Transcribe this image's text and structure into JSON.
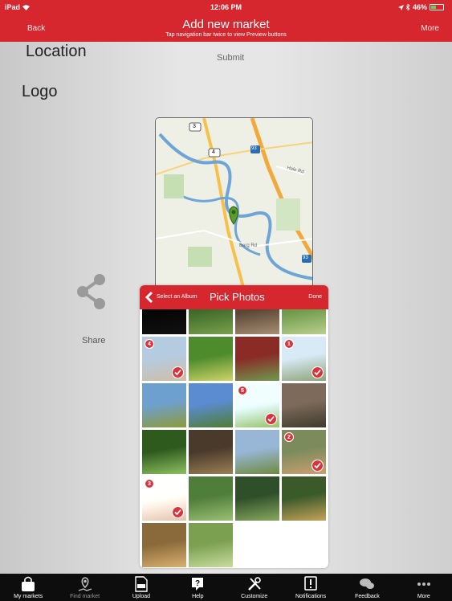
{
  "status_bar": {
    "carrier": "iPad",
    "time": "12:06 PM",
    "battery": "46%",
    "battery_level": 0.46
  },
  "nav": {
    "back": "Back",
    "title": "Add new market",
    "subtitle": "Tap navigation bar twice to view Preview buttons",
    "more": "More"
  },
  "form": {
    "location_label": "Location",
    "submit_label": "Submit",
    "logo_label": "Logo",
    "share_label": "Share"
  },
  "map": {
    "route_shields": [
      "3",
      "4",
      "93",
      "93"
    ],
    "roads": [
      "Hale Rd",
      "Borg Rd"
    ]
  },
  "picker": {
    "back_label": "Select an Album",
    "title": "Pick Photos",
    "done_label": "Done"
  },
  "photos": [
    {
      "badge": "",
      "selected": false
    },
    {
      "badge": "",
      "selected": false
    },
    {
      "badge": "",
      "selected": false
    },
    {
      "badge": "",
      "selected": false
    },
    {
      "badge": "4",
      "selected": true
    },
    {
      "badge": "",
      "selected": false
    },
    {
      "badge": "",
      "selected": false
    },
    {
      "badge": "1",
      "selected": true
    },
    {
      "badge": "",
      "selected": false
    },
    {
      "badge": "",
      "selected": false
    },
    {
      "badge": "5",
      "selected": true
    },
    {
      "badge": "",
      "selected": false
    },
    {
      "badge": "",
      "selected": false
    },
    {
      "badge": "",
      "selected": false
    },
    {
      "badge": "",
      "selected": false
    },
    {
      "badge": "2",
      "selected": true
    },
    {
      "badge": "3",
      "selected": true
    },
    {
      "badge": "",
      "selected": false
    },
    {
      "badge": "",
      "selected": false
    },
    {
      "badge": "",
      "selected": false
    },
    {
      "badge": "",
      "selected": false
    },
    {
      "badge": "",
      "selected": false
    }
  ],
  "tabs": [
    {
      "label": "My markets",
      "icon": "bag-icon"
    },
    {
      "label": "Find market",
      "icon": "map-pin-icon"
    },
    {
      "label": "Upload",
      "icon": "pdf-icon"
    },
    {
      "label": "Help",
      "icon": "help-icon"
    },
    {
      "label": "Customize",
      "icon": "tools-icon"
    },
    {
      "label": "Notifications",
      "icon": "notification-icon"
    },
    {
      "label": "Feedback",
      "icon": "feedback-icon"
    },
    {
      "label": "More",
      "icon": "more-icon"
    }
  ],
  "colors": {
    "brand_red": "#d6262e",
    "tab_bar": "#0d0d0d",
    "battery_green": "#4cd964"
  }
}
